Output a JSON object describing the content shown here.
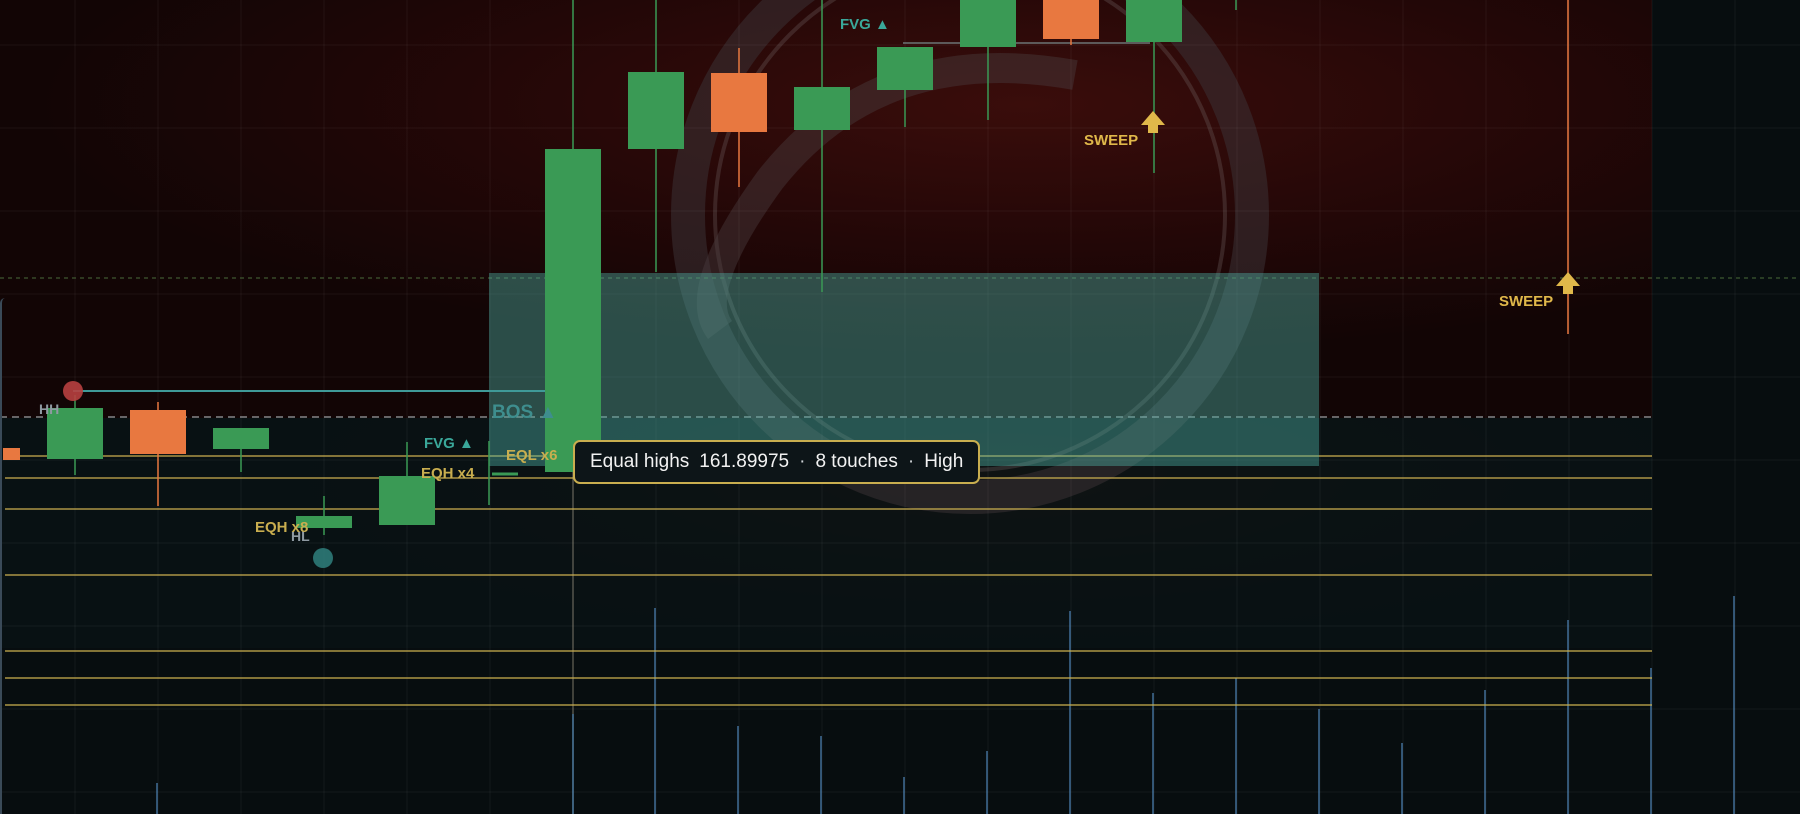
{
  "colors": {
    "background_dark": "#070d0f",
    "background_red": "#2a0707",
    "bull_candle": "#3a9a55",
    "bear_candle": "#e87840",
    "zone_teal": "#4fb3a8",
    "level_gold": "#c9ae4f",
    "sweep_gold": "#e0b84a",
    "volume_blue": "#4f86b8"
  },
  "labels": {
    "fvg_top": "FVG ▲",
    "fvg_mid": "FVG ▲",
    "sweep_1": "SWEEP",
    "sweep_2": "SWEEP",
    "hh": "HH",
    "hl": "HL",
    "bos": "BOS ▲",
    "eql": "EQL x6",
    "eqh_x4": "EQH x4",
    "eqh_x8": "EQH x8"
  },
  "tooltip": {
    "title": "Equal highs",
    "price": "161.89975",
    "touches": "8 touches",
    "sep": "·",
    "strength": "High"
  },
  "chart_data": {
    "type": "candlestick",
    "candles": [
      {
        "dir": "down"
      },
      {
        "dir": "up"
      },
      {
        "dir": "down"
      },
      {
        "dir": "up"
      },
      {
        "dir": "up"
      },
      {
        "dir": "up"
      },
      {
        "dir": "up"
      },
      {
        "dir": "up"
      },
      {
        "dir": "down"
      },
      {
        "dir": "up"
      },
      {
        "dir": "up"
      },
      {
        "dir": "up"
      },
      {
        "dir": "down"
      },
      {
        "dir": "up"
      }
    ],
    "markers": [
      "HH",
      "HL",
      "BOS ▲",
      "FVG ▲",
      "FVG ▲",
      "SWEEP",
      "SWEEP",
      "EQL x6",
      "EQH x4",
      "EQH x8"
    ],
    "equal_highs": {
      "price": 161.89975,
      "touches": 8,
      "strength": "High"
    }
  }
}
